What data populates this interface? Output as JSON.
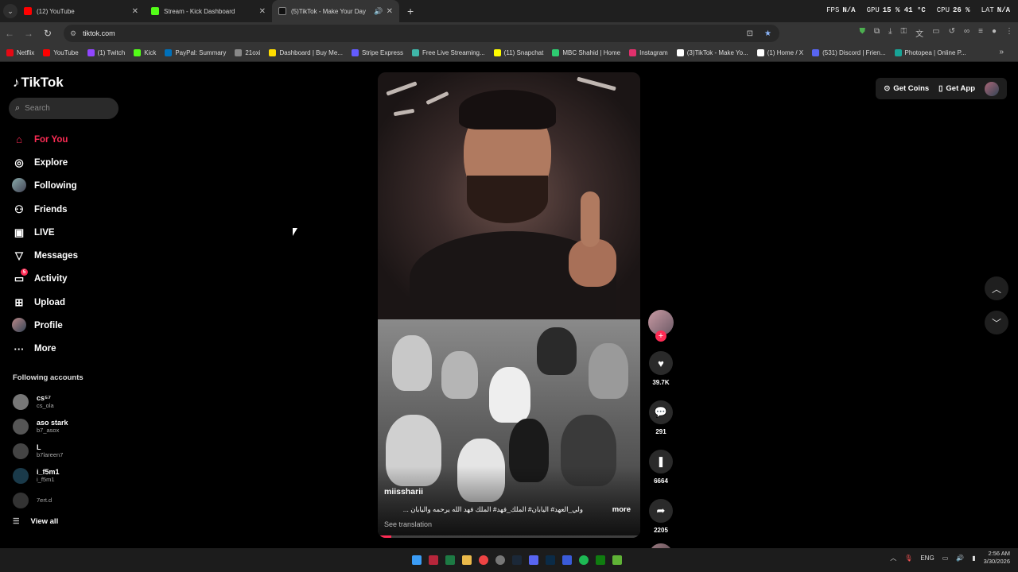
{
  "browser": {
    "tabs": [
      {
        "title": "(12) YouTube",
        "color": "#ff0000",
        "active": false
      },
      {
        "title": "Stream - Kick Dashboard",
        "color": "#53fc18",
        "active": false
      },
      {
        "title": "(5)TikTok - Make Your Day",
        "color": "#ffffff",
        "active": true
      }
    ],
    "perf": {
      "fps_label": "FPS",
      "fps": "N/A",
      "gpu_label": "GPU",
      "gpu": "15 % 41 °C",
      "cpu_label": "CPU",
      "cpu": "26 %",
      "lat_label": "LAT",
      "lat": "N/A"
    },
    "url": "tiktok.com",
    "bookmarks": [
      {
        "label": "Netflix",
        "color": "#e50914"
      },
      {
        "label": "YouTube",
        "color": "#ff0000"
      },
      {
        "label": "(1) Twitch",
        "color": "#9146ff"
      },
      {
        "label": "Kick",
        "color": "#53fc18"
      },
      {
        "label": "PayPal: Summary",
        "color": "#0070ba"
      },
      {
        "label": "21oxi",
        "color": "#888888"
      },
      {
        "label": "Dashboard | Buy Me...",
        "color": "#ffdd00"
      },
      {
        "label": "Stripe Express",
        "color": "#635bff"
      },
      {
        "label": "Free Live Streaming...",
        "color": "#3fb6a8"
      },
      {
        "label": "(11) Snapchat",
        "color": "#fffc00"
      },
      {
        "label": "MBC Shahid | Home",
        "color": "#2ecc71"
      },
      {
        "label": "Instagram",
        "color": "#e1306c"
      },
      {
        "label": "(3)TikTok - Make Yo...",
        "color": "#ffffff"
      },
      {
        "label": "(1) Home / X",
        "color": "#ffffff"
      },
      {
        "label": "(531) Discord | Frien...",
        "color": "#5865f2"
      },
      {
        "label": "Photopea | Online P...",
        "color": "#18a497"
      }
    ]
  },
  "tiktok": {
    "logo": "TikTok",
    "search_placeholder": "Search",
    "menu": [
      {
        "label": "For You",
        "icon": "home-icon",
        "glyph": "⌂",
        "active": true
      },
      {
        "label": "Explore",
        "icon": "compass-icon",
        "glyph": "◎",
        "active": false
      },
      {
        "label": "Following",
        "icon": "following-avatar-icon",
        "glyph": "",
        "active": false
      },
      {
        "label": "Friends",
        "icon": "friends-icon",
        "glyph": "⚇",
        "active": false
      },
      {
        "label": "LIVE",
        "icon": "live-icon",
        "glyph": "▣",
        "active": false
      },
      {
        "label": "Messages",
        "icon": "messages-icon",
        "glyph": "▽",
        "active": false
      },
      {
        "label": "Activity",
        "icon": "activity-icon",
        "glyph": "▭",
        "active": false,
        "badge": "5"
      },
      {
        "label": "Upload",
        "icon": "upload-icon",
        "glyph": "⊞",
        "active": false
      },
      {
        "label": "Profile",
        "icon": "profile-avatar-icon",
        "glyph": "",
        "active": false
      },
      {
        "label": "More",
        "icon": "more-icon",
        "glyph": "···",
        "active": false
      }
    ],
    "following_title": "Following accounts",
    "following": [
      {
        "name": "cs⁵⁷",
        "handle": "cs_ola",
        "color": "#777777"
      },
      {
        "name": "aso stark",
        "handle": "b7_asox",
        "color": "#555555"
      },
      {
        "name": "L",
        "handle": "b7lareen7",
        "color": "#444444"
      },
      {
        "name": "i_f5m1",
        "handle": "i_f5m1",
        "color": "#1a3a4a"
      },
      {
        "name": "",
        "handle": "7ert.d",
        "color": "#333333"
      }
    ],
    "view_all": "View all",
    "video": {
      "author": "miissharii",
      "caption": "ولي_العهد# اليابان# الملك_فهد# الملك فهد الله يرحمه واليابان ...",
      "more": "more",
      "see_translation": "See translation",
      "progress": 0.05
    },
    "actions": {
      "likes": "39.7K",
      "comments": "291",
      "saves": "6664",
      "shares": "2205"
    },
    "top_right": {
      "coins": "Get Coins",
      "app": "Get App"
    }
  },
  "taskbar": {
    "lang": "ENG",
    "time": "2:56 AM",
    "date": "3/30/2026"
  }
}
